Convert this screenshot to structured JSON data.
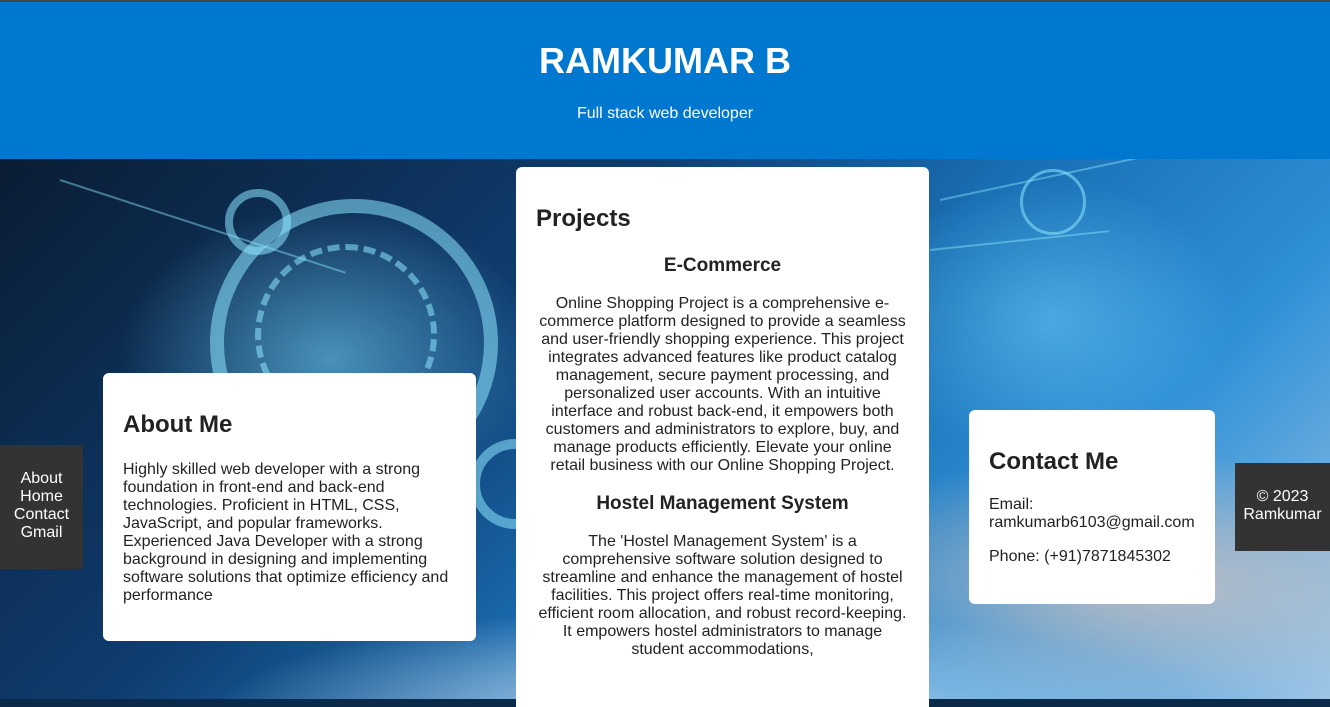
{
  "header": {
    "name": "RAMKUMAR B",
    "tagline": "Full stack web developer"
  },
  "sidebar": {
    "links": [
      "About",
      "Home",
      "Contact",
      "Gmail"
    ]
  },
  "about": {
    "heading": "About Me",
    "text": "Highly skilled web developer with a strong foundation in front-end and back-end technologies. Proficient in HTML, CSS, JavaScript, and popular frameworks. Experienced Java Developer with a strong background in designing and implementing software solutions that optimize efficiency and performance"
  },
  "projects": {
    "heading": "Projects",
    "items": [
      {
        "title": "E-Commerce",
        "description": "Online Shopping Project is a comprehensive e-commerce platform designed to provide a seamless and user-friendly shopping experience. This project integrates advanced features like product catalog management, secure payment processing, and personalized user accounts. With an intuitive interface and robust back-end, it empowers both customers and administrators to explore, buy, and manage products efficiently. Elevate your online retail business with our Online Shopping Project."
      },
      {
        "title": "Hostel Management System",
        "description": "The 'Hostel Management System' is a comprehensive software solution designed to streamline and enhance the management of hostel facilities. This project offers real-time monitoring, efficient room allocation, and robust record-keeping. It empowers hostel administrators to manage student accommodations,"
      }
    ]
  },
  "contact": {
    "heading": "Contact Me",
    "email": "Email: ramkumarb6103@gmail.com",
    "phone": "Phone: (+91)7871845302"
  },
  "footer": {
    "copyright": "© 2023 Ramkumar"
  },
  "colors": {
    "header_bg": "#0078d0",
    "panel_dark": "#333333",
    "card_bg": "#ffffff"
  }
}
